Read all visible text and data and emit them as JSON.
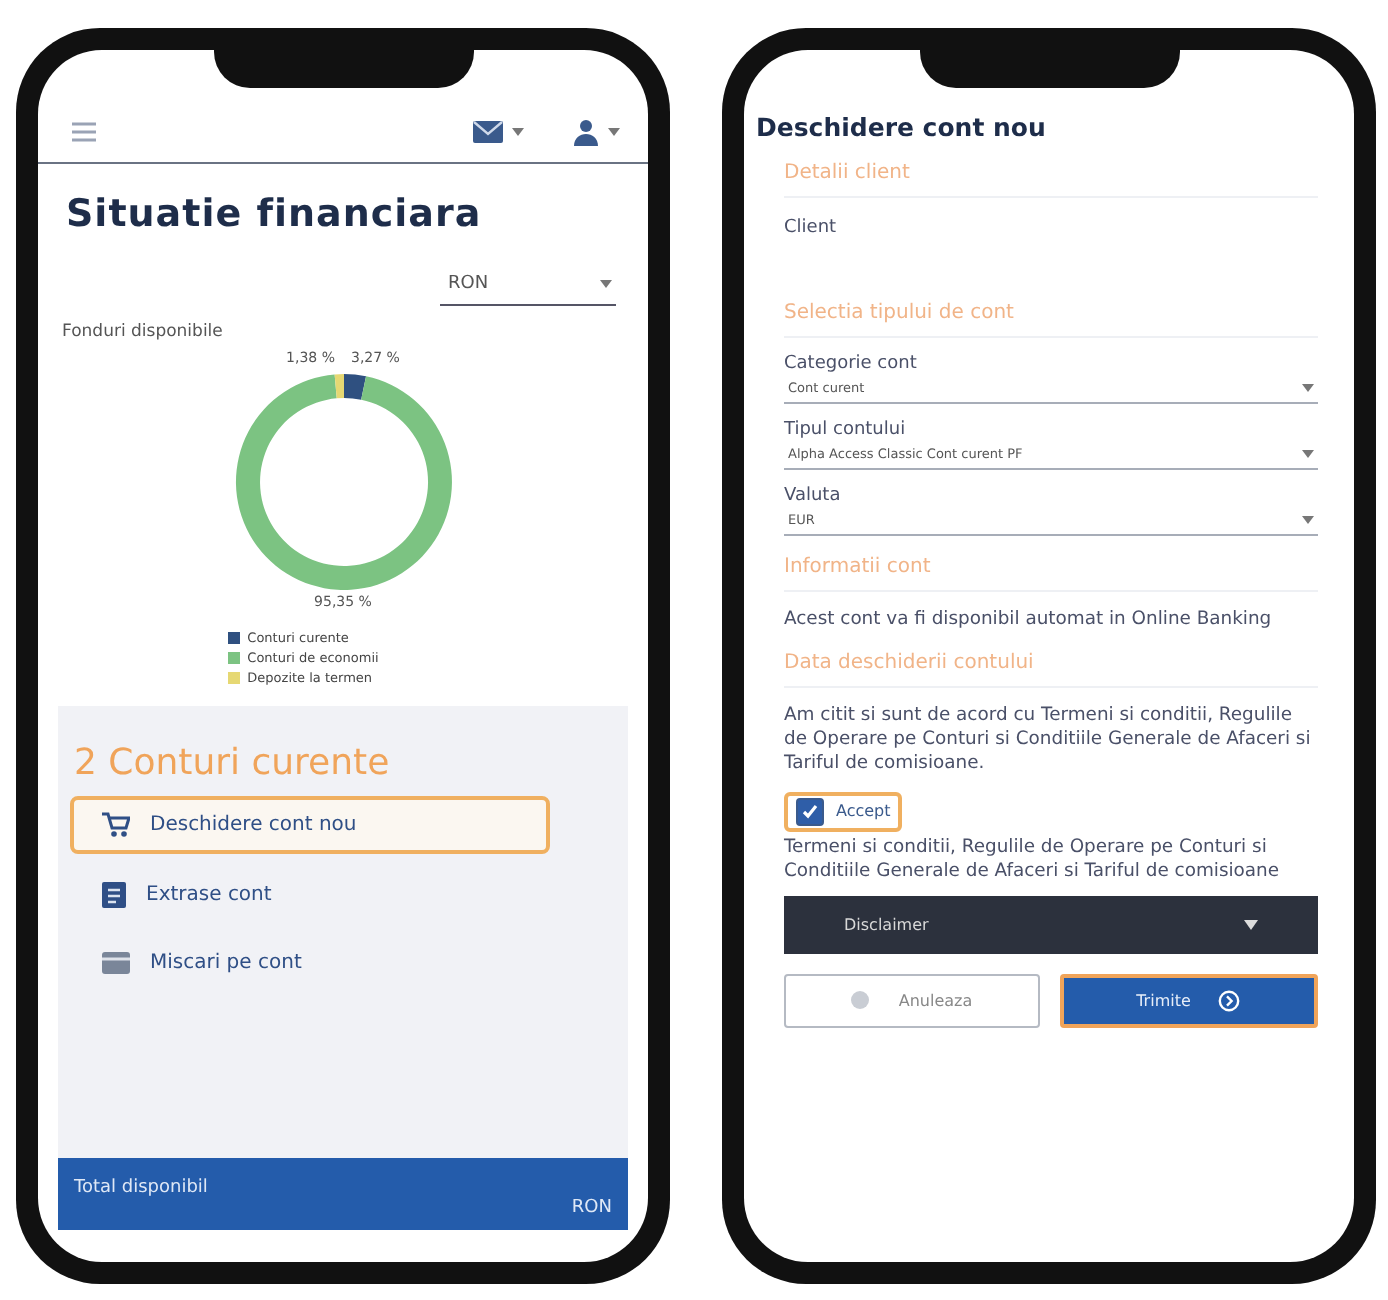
{
  "left_screen": {
    "title": "Situatie financiara",
    "currency_select": {
      "value": "RON"
    },
    "chart_data": {
      "type": "donut",
      "title": "Fonduri disponibile",
      "legend": "bottom",
      "categories": [
        "Conturi curente",
        "Conturi de economii",
        "Depozite la termen"
      ],
      "values": [
        3.27,
        95.35,
        1.38
      ],
      "colors": [
        "#2f5080",
        "#7cc382",
        "#e6d873"
      ],
      "value_labels": [
        "3,27 %",
        "95,35 %",
        "1,38 %"
      ]
    },
    "accounts": {
      "heading": "2 Conturi curente",
      "actions": [
        {
          "label": "Deschidere cont nou",
          "kind": "cart",
          "focused": true
        },
        {
          "label": "Extrase cont",
          "kind": "statement",
          "focused": false
        },
        {
          "label": "Miscari pe cont",
          "kind": "card",
          "focused": false
        }
      ]
    },
    "total_bar": {
      "label": "Total disponibil",
      "currency": "RON"
    }
  },
  "right_screen": {
    "title": "Deschidere cont nou",
    "client_section": {
      "heading": "Detalii client",
      "label": "Client"
    },
    "account_type_section": {
      "heading": "Selectia tipului de cont",
      "fields": [
        {
          "label": "Categorie cont",
          "value": "Cont curent"
        },
        {
          "label": "Tipul contului",
          "value": "Alpha Access Classic Cont curent PF"
        },
        {
          "label": "Valuta",
          "value": "EUR"
        }
      ]
    },
    "info_section": {
      "heading": "Informatii cont",
      "text": "Acest cont va fi disponibil automat in Online Banking"
    },
    "opening_section": {
      "heading": "Data deschiderii contului",
      "agreement": "Am citit si sunt de acord cu Termeni si conditii, Regulile de Operare pe Conturi si Conditiile Generale de Afaceri si Tariful de comisioane.",
      "accept": {
        "label": "Accept",
        "checked": true,
        "focused": true
      },
      "terms": "Termeni si conditii, Regulile de Operare pe Conturi si Conditiile Generale de Afaceri si Tariful de comisioane"
    },
    "disclaimer": {
      "label": "Disclaimer",
      "expanded": false
    },
    "buttons": [
      {
        "label": "Anuleaza",
        "kind": "cancel",
        "focused": false
      },
      {
        "label": "Trimite",
        "kind": "submit",
        "focused": true
      }
    ]
  }
}
